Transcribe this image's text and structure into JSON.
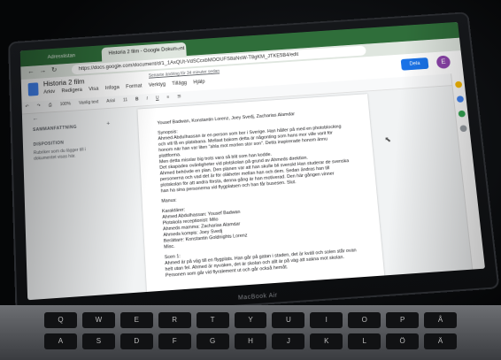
{
  "browser": {
    "tabs": [
      {
        "label": "Adresslistan",
        "active": false
      },
      {
        "label": "Historia 2 film - Google Dokument",
        "active": true
      }
    ],
    "new_tab_glyph": "+",
    "url": "https://docs.google.com/document/d/1_1AxQUt-VdSCcxbMOOUFS8aNsW-T8gKM_JTKE5B4/edit"
  },
  "docs": {
    "title": "Historia 2 film",
    "saved_status": "Senaste ändring för 34 minuter sedan",
    "menu": [
      "Arkiv",
      "Redigera",
      "Visa",
      "Infoga",
      "Format",
      "Verktyg",
      "Tillägg",
      "Hjälp"
    ],
    "share_label": "Dela",
    "avatar_letter": "E",
    "toolbar": {
      "zoom": "100%",
      "style": "Vanlig text",
      "font": "Arial",
      "size": "11"
    },
    "outline": {
      "heading": "SAMMANFATTNING",
      "sub_heading": "DISPOSITION",
      "hint": "Rubriker som du lägger till i dokumentet visas här."
    }
  },
  "document": {
    "authors": "Yousef Badwan, Konstantin Lorenz, Joey Svedj, Zacharias Alamdar",
    "synopsis_label": "Synopsis:",
    "synopsis_lines": [
      "Ahmed Abdulhassan är en person som bor i Sverige. Han håller på med en photoblocking",
      "och vill få en platsbana. Mellast bakom detta är någonting som hans mor ville varit för",
      "honom när han var liten \"ahla mot morlen stor son\". Detta inspirerade honom ännu",
      "plattforma.",
      "Men detta misslar big trots vara så blit som han kodde.",
      "Det skapades ovänligheter vid plotskolan på grund av Ahmeds direktion.",
      "Ahmed behövde en plan. Den planen var att han skulle bli svenskt Han studerar de svenska",
      "personerna och vad det är för olikheter mellan han och dem. Sedan ändras han till",
      "plotskolan för att andra första, denna gång är han motiverad. Den här gången vinner",
      "han ha sina personerna vid flygplatsen och han får busesen. Slut."
    ],
    "manus_label": "Manus:",
    "karaktarer_label": "Karaktärer:",
    "cast": [
      "Ahmed Abdulhassan: Yousef Badwan",
      "Plotskola receptionist: Milo",
      "Ahmeds mamma: Zacharias Alamdar",
      "Ahmeds kompis: Joey Svedj",
      "Berättare: Konstantin Goldnights Lorenz",
      "Misc."
    ],
    "scene_label": "Scen 1:",
    "scene_lines": [
      "Ahmed är på väg till en flygplats. Han går på gatan i staden, det är kväll och solen står ovan",
      "helt utan fel. Ahmed är nyvaken, det är skolan och allt är på väg att sakna mot skolan.",
      "Personen som går vid flyralement ut och går också hemåt."
    ]
  },
  "device": {
    "brand": "MacBook Air"
  },
  "keyboard": {
    "row1": [
      "Q",
      "W",
      "E",
      "R",
      "T",
      "Y",
      "U",
      "I",
      "O",
      "P",
      "Å"
    ],
    "row2": [
      "A",
      "S",
      "D",
      "F",
      "G",
      "H",
      "J",
      "K",
      "L",
      "Ö",
      "Ä"
    ]
  },
  "colors": {
    "tabbar": "#2f6e3a",
    "share": "#1a73e8",
    "avatar": "#8e44ad"
  }
}
